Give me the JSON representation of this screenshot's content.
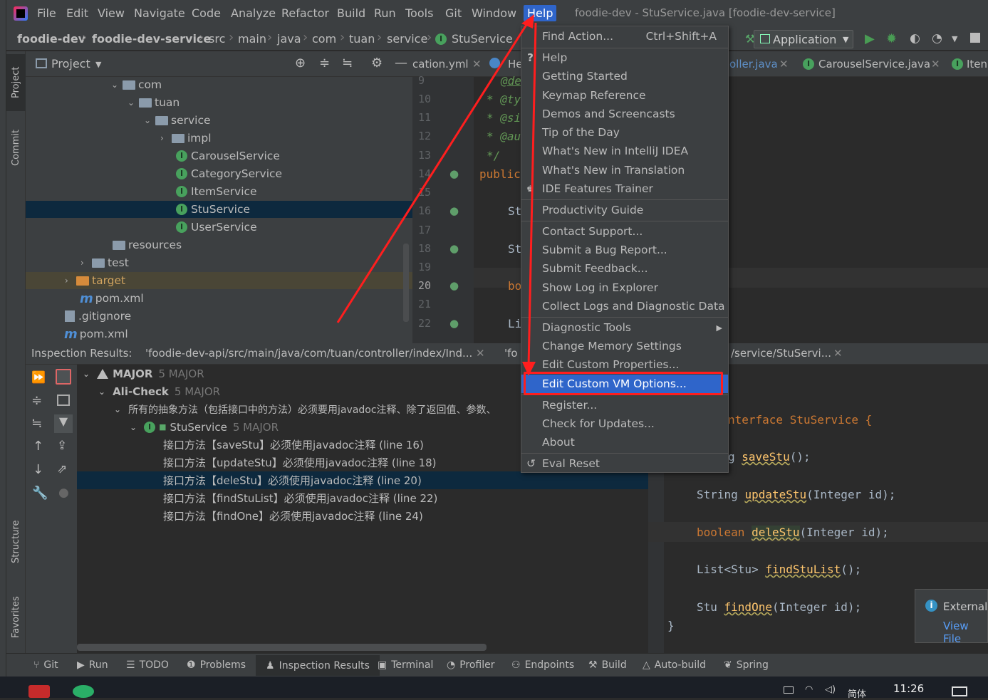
{
  "window": {
    "title": "foodie-dev - StuService.java [foodie-dev-service]"
  },
  "menubar": {
    "items": [
      "File",
      "Edit",
      "View",
      "Navigate",
      "Code",
      "Analyze",
      "Refactor",
      "Build",
      "Run",
      "Tools",
      "Git",
      "Window",
      "Help"
    ],
    "active": "Help"
  },
  "navbar": {
    "crumbs": [
      "foodie-dev",
      "foodie-dev-service",
      "src",
      "main",
      "java",
      "com",
      "tuan",
      "service",
      "StuService"
    ]
  },
  "run_config": {
    "label": "Application"
  },
  "project_panel": {
    "title": "Project"
  },
  "project_tree": [
    {
      "label": "com",
      "kind": "folder"
    },
    {
      "label": "tuan",
      "kind": "folder"
    },
    {
      "label": "service",
      "kind": "folder"
    },
    {
      "label": "impl",
      "kind": "folder"
    },
    {
      "label": "CarouselService",
      "kind": "interface"
    },
    {
      "label": "CategoryService",
      "kind": "interface"
    },
    {
      "label": "ItemService",
      "kind": "interface"
    },
    {
      "label": "StuService",
      "kind": "interface",
      "selected": true
    },
    {
      "label": "UserService",
      "kind": "interface"
    },
    {
      "label": "resources",
      "kind": "folder"
    },
    {
      "label": "test",
      "kind": "folder"
    },
    {
      "label": "target",
      "kind": "folder-excluded"
    },
    {
      "label": "pom.xml",
      "kind": "maven"
    },
    {
      "label": ".gitignore",
      "kind": "file"
    },
    {
      "label": "pom.xml",
      "kind": "maven"
    }
  ],
  "editor_tabs": [
    "cation.yml",
    "He",
    "oller.java",
    "CarouselService.java",
    "Iten"
  ],
  "editor_lines": [
    {
      "n": "9",
      "text": "@de"
    },
    {
      "n": "10",
      "text": "* @ty"
    },
    {
      "n": "11",
      "text": "* @si"
    },
    {
      "n": "12",
      "text": "* @au"
    },
    {
      "n": "13",
      "text": "*/"
    },
    {
      "n": "14",
      "text": "public"
    },
    {
      "n": "15",
      "text": ""
    },
    {
      "n": "16",
      "text": "St"
    },
    {
      "n": "17",
      "text": ""
    },
    {
      "n": "18",
      "text": "St"
    },
    {
      "n": "19",
      "text": ""
    },
    {
      "n": "20",
      "text": "bo"
    },
    {
      "n": "21",
      "text": ""
    },
    {
      "n": "22",
      "text": "Li"
    }
  ],
  "inspection_bar": {
    "label": "Inspection Results:",
    "tab1": "'foodie-dev-api/src/main/java/com/tuan/controller/index/Ind...",
    "tab2": "'fo",
    "tab3": "/service/StuServi..."
  },
  "inspection_tree": {
    "major": {
      "label": "MAJOR",
      "count": "5 MAJOR"
    },
    "ali": {
      "label": "Ali-Check",
      "count": "5 MAJOR"
    },
    "rule": "所有的抽象方法（包括接口中的方法）必须要用javadoc注释、除了返回值、参数、",
    "file": {
      "label": "StuService",
      "count": "5 MAJOR"
    },
    "issues": [
      "接口方法【saveStu】必须使用javadoc注释 (line 16)",
      "接口方法【updateStu】必须使用javadoc注释 (line 18)",
      "接口方法【deleStu】必须使用javadoc注释 (line 20)",
      "接口方法【findStuList】必须使用javadoc注释 (line 22)",
      "接口方法【findOne】必须使用javadoc注释 (line 24)"
    ]
  },
  "right_code": {
    "decl": "nterface StuService {",
    "save_prefix": "g ",
    "save_name": "saveStu",
    "save_tail": "();",
    "update_type": "String ",
    "update_name": "updateStu",
    "update_tail": "(Integer id);",
    "dele_type": "boolean ",
    "dele_name": "deleStu",
    "dele_tail": "(Integer id);",
    "find_type": "List<Stu> ",
    "find_name": "findStuList",
    "find_tail": "();",
    "one_type": "Stu ",
    "one_name": "findOne",
    "one_tail": "(Integer id);",
    "close": "}"
  },
  "help_menu": [
    {
      "label": "Find Action...",
      "shortcut": "Ctrl+Shift+A"
    },
    {
      "label": "Help",
      "icon": "?"
    },
    {
      "label": "Getting Started"
    },
    {
      "label": "Keymap Reference"
    },
    {
      "label": "Demos and Screencasts"
    },
    {
      "label": "Tip of the Day"
    },
    {
      "label": "What's New in IntelliJ IDEA"
    },
    {
      "label": "What's New in Translation"
    },
    {
      "label": "IDE Features Trainer"
    },
    {
      "label": "Productivity Guide"
    },
    {
      "label": "Contact Support..."
    },
    {
      "label": "Submit a Bug Report..."
    },
    {
      "label": "Submit Feedback..."
    },
    {
      "label": "Show Log in Explorer"
    },
    {
      "label": "Collect Logs and Diagnostic Data"
    },
    {
      "label": "Diagnostic Tools"
    },
    {
      "label": "Change Memory Settings"
    },
    {
      "label": "Edit Custom Properties..."
    },
    {
      "label": "Edit Custom VM Options...",
      "highlighted": true
    },
    {
      "label": "Register..."
    },
    {
      "label": "Check for Updates..."
    },
    {
      "label": "About"
    },
    {
      "label": "Eval Reset"
    }
  ],
  "toolstrip": {
    "project": "Project",
    "commit": "Commit",
    "structure": "Structure",
    "favorites": "Favorites"
  },
  "statusbar": [
    "Git",
    "Run",
    "TODO",
    "Problems",
    "Inspection Results",
    "Terminal",
    "Profiler",
    "Endpoints",
    "Build",
    "Auto-build",
    "Spring"
  ],
  "notification": {
    "title": "Externall",
    "link": "View File"
  },
  "taskbar": {
    "time": "11:26",
    "lang": "简体"
  },
  "colors": {
    "accent": "#2f65ca",
    "annotation": "#ff1e1e",
    "bg": "#2b2b2b",
    "panel": "#3c3f41"
  }
}
